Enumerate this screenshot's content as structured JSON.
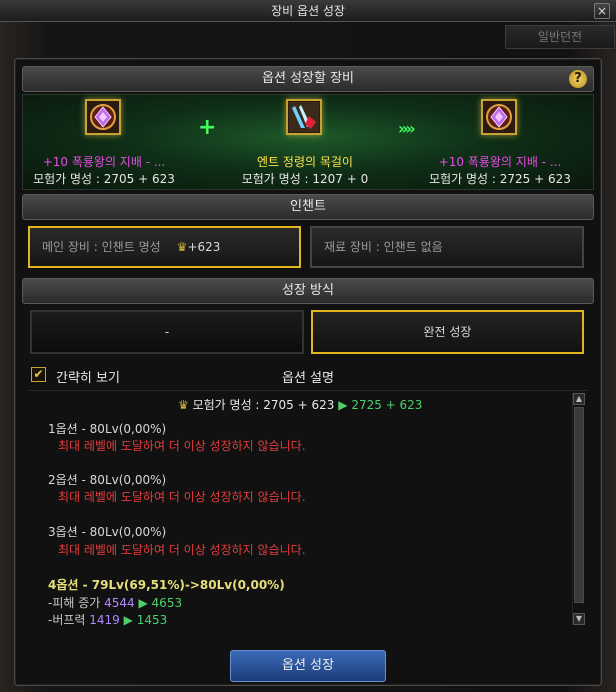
{
  "window": {
    "title": "장비 옵션 성장",
    "close_label": "×"
  },
  "background_tab": {
    "label": "일반던전"
  },
  "growth_equipment": {
    "header": "옵션 성장할 장비",
    "help_label": "?",
    "main_item": {
      "enhance": "+10",
      "name": " 폭룡왕의 지배 - ...",
      "fame": "모험가 명성 : 2705 + 623",
      "icon": "gem-ring-icon"
    },
    "plus_symbol": "+",
    "material_item": {
      "name": "엔트 정령의 목걸이",
      "fame": "모험가 명성 : 1207 + 0",
      "icon": "necklace-icon"
    },
    "arrow_symbol": "»»",
    "result_item": {
      "enhance": "+10",
      "name": " 폭룡왕의 지배 - ...",
      "fame": "모험가 명성 : 2725 + 623",
      "icon": "gem-ring-icon"
    }
  },
  "enchant": {
    "header": "인챈트",
    "main_label": "메인 장비 : 인챈트 명성",
    "main_value": "+623",
    "material_label": "재료 장비 : 인챈트 없음"
  },
  "growth_method": {
    "header": "성장 방식",
    "option_left": "-",
    "option_right": "완전 성장"
  },
  "description": {
    "checkbox_label": "간략히 보기",
    "checkbox_mark": "✔",
    "title": "옵션 설명",
    "fame_before": "모험가 명성 : 2705 + 623",
    "fame_after": "2725 + 623",
    "options": [
      {
        "line": "1옵션 - 80Lv(0,00%)",
        "note": "최대 레벨에 도달하여 더 이상 성장하지 않습니다."
      },
      {
        "line": "2옵션 - 80Lv(0,00%)",
        "note": "최대 레벨에 도달하여 더 이상 성장하지 않습니다."
      },
      {
        "line": "3옵션 - 80Lv(0,00%)",
        "note": "최대 레벨에 도달하여 더 이상 성장하지 않습니다."
      }
    ],
    "option4": {
      "line": "4옵션 - 79Lv(69,51%)->80Lv(0,00%)",
      "stats": [
        {
          "label": "-피해 증가 ",
          "old": "4544",
          "new": " 4653"
        },
        {
          "label": "-버프력 ",
          "old": "1419",
          "new": " 1453"
        }
      ]
    }
  },
  "action": {
    "grow_button": "옵션 성장"
  },
  "colors": {
    "accent_gold": "#e2b420",
    "positive_green": "#4dd06a",
    "warning_red": "#e43b3b",
    "button_blue": "#2d56a0"
  }
}
